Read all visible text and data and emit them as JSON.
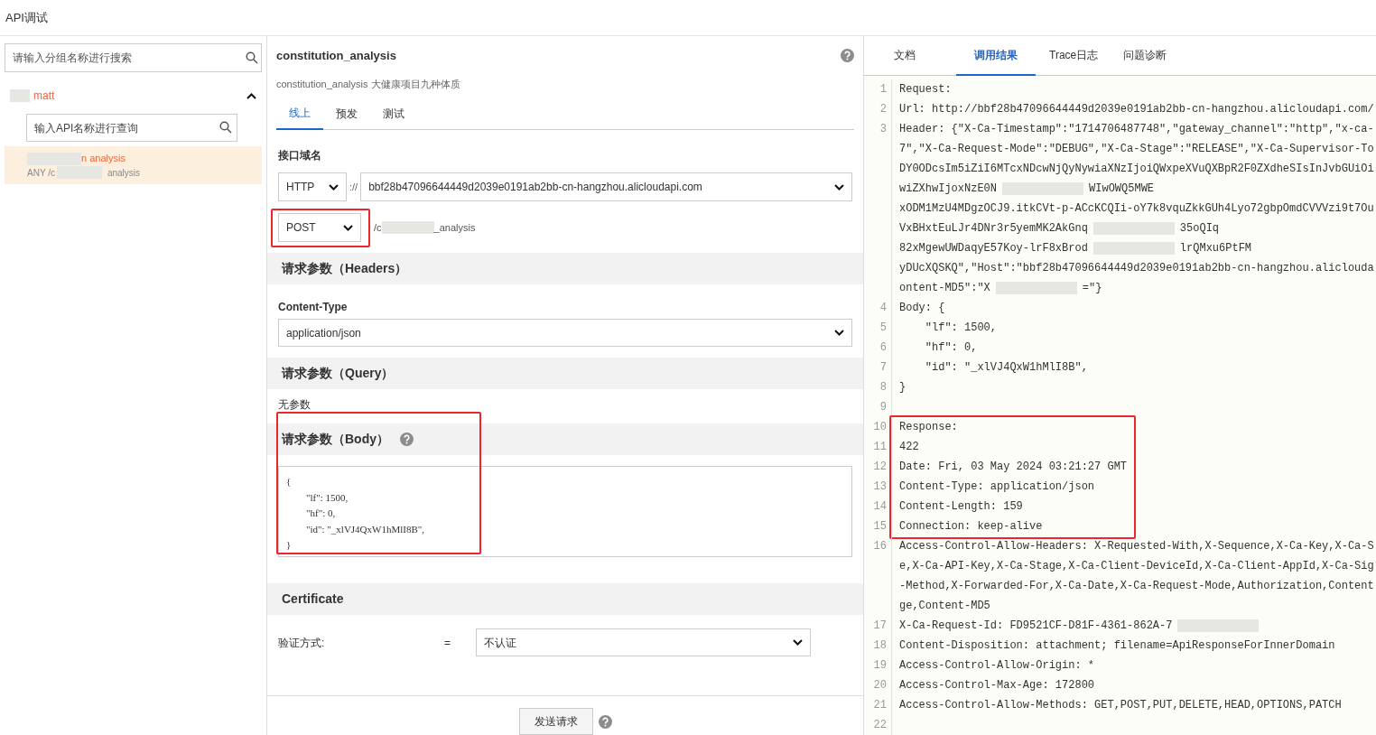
{
  "header": {
    "title": "API调试"
  },
  "sidebar": {
    "group_search": {
      "placeholder": "请输入分组名称进行搜索"
    },
    "group": {
      "name": "matt",
      "expanded": true,
      "api_search": {
        "placeholder": "输入API名称进行查询"
      },
      "apis": [
        {
          "name": "n analysis",
          "path_start": "ANY /c",
          "path_end": "analysis",
          "selected": true
        }
      ]
    }
  },
  "main": {
    "title": "constitution_analysis",
    "description": "constitution_analysis 大健康项目九种体质",
    "tabs": [
      {
        "label": "线上",
        "selected": true
      },
      {
        "label": "预发",
        "selected": false
      },
      {
        "label": "测试",
        "selected": false
      }
    ],
    "domain_label": "接口域名",
    "protocol": "HTTP",
    "separator": "://",
    "domain": "bbf28b47096644449d2039e0191ab2bb-cn-hangzhou.alicloudapi.com",
    "method": "POST",
    "path_start": "/c",
    "path_end": "_analysis",
    "method_highlighted": true,
    "sections": [
      {
        "kind": "header",
        "title": "请求参数（Headers）"
      },
      {
        "kind": "select",
        "label": "Content-Type",
        "value": "application/json"
      },
      {
        "kind": "header",
        "title": "请求参数（Query）"
      },
      {
        "kind": "note",
        "text": "无参数"
      },
      {
        "kind": "header",
        "title": "请求参数（Body）",
        "help": true
      },
      {
        "kind": "body",
        "lines": [
          "{",
          "        \"lf\": 1500,",
          "        \"hf\": 0,",
          "        \"id\": \"_xlVJ4QxW1hMlI8B\",",
          "}"
        ],
        "highlighted": true
      },
      {
        "kind": "header",
        "title": "Certificate"
      },
      {
        "kind": "auth",
        "label": "验证方式:",
        "equals": "=",
        "value": "不认证"
      }
    ],
    "send_button": "发送请求"
  },
  "result": {
    "tabs": [
      {
        "label": "文档",
        "selected": false
      },
      {
        "label": "调用结果",
        "selected": true
      },
      {
        "label": "Trace日志",
        "selected": false
      },
      {
        "label": "问题诊断",
        "selected": false
      }
    ],
    "lines": [
      {
        "number": "1",
        "rows": [
          [
            {
              "kind": "text",
              "text": "Request:"
            }
          ]
        ]
      },
      {
        "number": "2",
        "rows": [
          [
            {
              "kind": "text",
              "text": "Url: http://bbf28b47096644449d2039e0191ab2bb-cn-hangzhou.alicloudapi.com/"
            }
          ]
        ]
      },
      {
        "number": "3",
        "rows": [
          [
            {
              "kind": "text",
              "text": "Header: {\"X-Ca-Timestamp\":\"1714706487748\",\"gateway_channel\":\"http\",\"x-ca-"
            }
          ],
          [
            {
              "kind": "text",
              "text": "7\",\"X-Ca-Request-Mode\":\"DEBUG\",\"X-Ca-Stage\":\"RELEASE\",\"X-Ca-Supervisor-To"
            }
          ],
          [
            {
              "kind": "text",
              "text": "DY0ODcsIm5iZiI6MTcxNDcwNjQyNywiaXNzIjoiQWxpeXVuQXBpR2F0ZXdheSIsInJvbGUiOi"
            }
          ],
          [
            {
              "kind": "text",
              "text": "wiZXhwIjoxNzE0N"
            },
            {
              "kind": "blur"
            },
            {
              "kind": "text",
              "text": "WIwOWQ5MWE"
            }
          ],
          [
            {
              "kind": "text",
              "text": "xODM1MzU4MDgzOCJ9.itkCVt-p-ACcKCQIi-oY7k8vquZkkGUh4Lyo72gbpOmdCVVVzi9t7Ou"
            }
          ],
          [
            {
              "kind": "text",
              "text": "VxBHxtEuLJr4DNr3r5yemMK2AkGnq"
            },
            {
              "kind": "blur"
            },
            {
              "kind": "text",
              "text": "35oQIq"
            }
          ],
          [
            {
              "kind": "text",
              "text": "82xMgewUWDaqyE57Koy-lrF8xBrod"
            },
            {
              "kind": "blur"
            },
            {
              "kind": "text",
              "text": "lrQMxu6PtFM"
            }
          ],
          [
            {
              "kind": "text",
              "text": "yDUcXQSKQ\",\"Host\":\"bbf28b47096644449d2039e0191ab2bb-cn-hangzhou.aliclouda"
            }
          ],
          [
            {
              "kind": "text",
              "text": "ontent-MD5\":\"X"
            },
            {
              "kind": "blur"
            },
            {
              "kind": "text",
              "text": "=\"}"
            }
          ]
        ]
      },
      {
        "number": "4",
        "rows": [
          [
            {
              "kind": "text",
              "text": "Body: {"
            }
          ]
        ]
      },
      {
        "number": "5",
        "rows": [
          [
            {
              "kind": "text",
              "text": "    \"lf\": 1500,"
            }
          ]
        ]
      },
      {
        "number": "6",
        "rows": [
          [
            {
              "kind": "text",
              "text": "    \"hf\": 0,"
            }
          ]
        ]
      },
      {
        "number": "7",
        "rows": [
          [
            {
              "kind": "text",
              "text": "    \"id\": \"_xlVJ4QxW1hMlI8B\","
            }
          ]
        ]
      },
      {
        "number": "8",
        "rows": [
          [
            {
              "kind": "text",
              "text": "}"
            }
          ]
        ]
      },
      {
        "number": "9",
        "rows": [
          []
        ]
      },
      {
        "number": "10",
        "rows": [
          [
            {
              "kind": "text",
              "text": "Response:"
            }
          ]
        ],
        "highlighted": true
      },
      {
        "number": "11",
        "rows": [
          [
            {
              "kind": "text",
              "text": "422"
            }
          ]
        ],
        "highlighted": true
      },
      {
        "number": "12",
        "rows": [
          [
            {
              "kind": "text",
              "text": "Date: Fri, 03 May 2024 03:21:27 GMT"
            }
          ]
        ],
        "highlighted": true
      },
      {
        "number": "13",
        "rows": [
          [
            {
              "kind": "text",
              "text": "Content-Type: application/json"
            }
          ]
        ],
        "highlighted": true
      },
      {
        "number": "14",
        "rows": [
          [
            {
              "kind": "text",
              "text": "Content-Length: 159"
            }
          ]
        ],
        "highlighted": true
      },
      {
        "number": "15",
        "rows": [
          [
            {
              "kind": "text",
              "text": "Connection: keep-alive"
            }
          ]
        ],
        "highlighted": true
      },
      {
        "number": "16",
        "rows": [
          [
            {
              "kind": "text",
              "text": "Access-Control-Allow-Headers: X-Requested-With,X-Sequence,X-Ca-Key,X-Ca-S"
            }
          ],
          [
            {
              "kind": "text",
              "text": "e,X-Ca-API-Key,X-Ca-Stage,X-Ca-Client-DeviceId,X-Ca-Client-AppId,X-Ca-Sig"
            }
          ],
          [
            {
              "kind": "text",
              "text": "-Method,X-Forwarded-For,X-Ca-Date,X-Ca-Request-Mode,Authorization,Content"
            }
          ],
          [
            {
              "kind": "text",
              "text": "ge,Content-MD5"
            }
          ]
        ]
      },
      {
        "number": "17",
        "rows": [
          [
            {
              "kind": "text",
              "text": "X-Ca-Request-Id: FD9521CF-D81F-4361-862A-7"
            },
            {
              "kind": "blur"
            }
          ]
        ]
      },
      {
        "number": "18",
        "rows": [
          [
            {
              "kind": "text",
              "text": "Content-Disposition: attachment; filename=ApiResponseForInnerDomain"
            }
          ]
        ]
      },
      {
        "number": "19",
        "rows": [
          [
            {
              "kind": "text",
              "text": "Access-Control-Allow-Origin: *"
            }
          ]
        ]
      },
      {
        "number": "20",
        "rows": [
          [
            {
              "kind": "text",
              "text": "Access-Control-Max-Age: 172800"
            }
          ]
        ]
      },
      {
        "number": "21",
        "rows": [
          [
            {
              "kind": "text",
              "text": "Access-Control-Allow-Methods: GET,POST,PUT,DELETE,HEAD,OPTIONS,PATCH"
            }
          ]
        ]
      },
      {
        "number": "22",
        "rows": [
          []
        ]
      }
    ]
  }
}
